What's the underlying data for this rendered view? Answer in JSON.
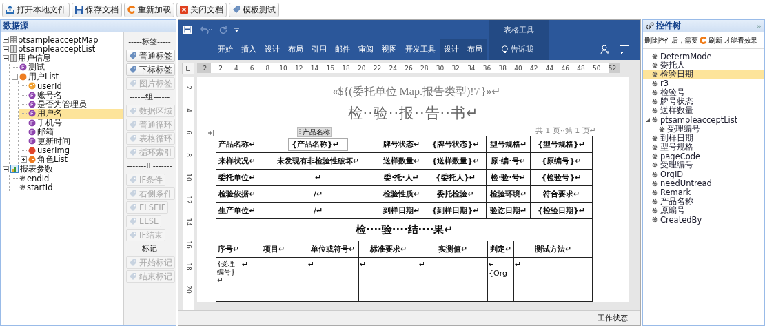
{
  "toolbar": [
    {
      "kind": "open",
      "label": "打开本地文件"
    },
    {
      "kind": "save",
      "label": "保存文档"
    },
    {
      "kind": "reload",
      "label": "重新加载"
    },
    {
      "kind": "close",
      "label": "关闭文档"
    },
    {
      "kind": "test",
      "label": "模板测试"
    }
  ],
  "datasource": {
    "title": "数据源",
    "tree": [
      {
        "kind": "table",
        "label": "ptsampleacceptMap",
        "expanded": false,
        "selected": false
      },
      {
        "kind": "table",
        "label": "ptsampleacceptList",
        "expanded": false,
        "selected": false
      },
      {
        "kind": "table",
        "label": "用户信息",
        "expanded": true,
        "selected": false,
        "children": [
          {
            "kind": "field",
            "label": "测试",
            "selected": false
          },
          {
            "kind": "list",
            "label": "用户List",
            "expanded": true,
            "selected": false,
            "children": [
              {
                "kind": "key",
                "label": "userId",
                "selected": false
              },
              {
                "kind": "field",
                "label": "账号名",
                "selected": false
              },
              {
                "kind": "field",
                "label": "是否为管理员",
                "selected": false
              },
              {
                "kind": "field",
                "label": "用户名",
                "selected": true
              },
              {
                "kind": "field",
                "label": "手机号",
                "selected": false
              },
              {
                "kind": "field",
                "label": "邮箱",
                "selected": false
              },
              {
                "kind": "field",
                "label": "更新时间",
                "selected": false
              },
              {
                "kind": "image",
                "label": "userImg",
                "selected": false
              },
              {
                "kind": "list",
                "label": "角色List",
                "expanded": false,
                "selected": false
              }
            ]
          }
        ]
      },
      {
        "kind": "report",
        "label": "报表参数",
        "expanded": true,
        "selected": false,
        "children": [
          {
            "kind": "param",
            "label": "endId",
            "selected": false
          },
          {
            "kind": "param",
            "label": "startId",
            "selected": false
          }
        ]
      }
    ]
  },
  "tag_palette": [
    {
      "kind": "heading",
      "label": "-----标签-----"
    },
    {
      "kind": "button",
      "label": "普通标签",
      "disabled": false
    },
    {
      "kind": "button",
      "label": "下标标签",
      "disabled": false
    },
    {
      "kind": "button",
      "label": "图片标签",
      "disabled": true
    },
    {
      "kind": "heading",
      "label": "------组------"
    },
    {
      "kind": "button",
      "label": "数据区域",
      "disabled": true
    },
    {
      "kind": "button",
      "label": "普通循环",
      "disabled": true
    },
    {
      "kind": "button",
      "label": "表格循环",
      "disabled": true
    },
    {
      "kind": "button",
      "label": "循环索引",
      "disabled": true
    },
    {
      "kind": "heading",
      "label": "-------IF-------"
    },
    {
      "kind": "button",
      "label": "IF条件",
      "disabled": true
    },
    {
      "kind": "button",
      "label": "右侧条件",
      "disabled": true
    },
    {
      "kind": "button",
      "label": "ELSEIF",
      "disabled": true
    },
    {
      "kind": "button",
      "label": "ELSE",
      "disabled": true
    },
    {
      "kind": "button",
      "label": "IF结束",
      "disabled": true
    },
    {
      "kind": "heading",
      "label": "-----标记-----"
    },
    {
      "kind": "button",
      "label": "开始标记",
      "disabled": true
    },
    {
      "kind": "button",
      "label": "结束标记",
      "disabled": true
    }
  ],
  "ribbon": {
    "context_group": "表格工具",
    "tabs": [
      {
        "label": "开始",
        "contextual": false
      },
      {
        "label": "插入",
        "contextual": false
      },
      {
        "label": "设计",
        "contextual": false
      },
      {
        "label": "布局",
        "contextual": false
      },
      {
        "label": "引用",
        "contextual": false
      },
      {
        "label": "邮件",
        "contextual": false
      },
      {
        "label": "审阅",
        "contextual": false
      },
      {
        "label": "视图",
        "contextual": false
      },
      {
        "label": "开发工具",
        "contextual": false
      },
      {
        "label": "设计",
        "contextual": true
      },
      {
        "label": "布局",
        "contextual": true
      }
    ],
    "tell_me": "告诉我"
  },
  "ruler": {
    "numbers": [
      "2",
      "2",
      "4",
      "6",
      "8",
      "10",
      "12",
      "14",
      "16",
      "18",
      "20",
      "22",
      "24",
      "26",
      "28",
      "30",
      "32",
      "34",
      "36",
      "38",
      "40",
      "42",
      "44",
      "46",
      "48",
      "50",
      "52"
    ]
  },
  "vertical_ruler": {
    "numbers": [
      "2",
      "4",
      "6",
      "8",
      "10",
      "12",
      "14",
      "16",
      "18",
      "20"
    ]
  },
  "document": {
    "header_expr": "«${(委托单位 Map.报告类型)!'/'}»↵",
    "title": "检··验··报··告··书↵",
    "page_info": "共 1 页··第 1 页↵",
    "field_tag": "产品名称",
    "info_table": [
      [
        "产品名称↵",
        "{产品名称}↵",
        "牌号状态↵",
        "{牌号状态}↵",
        "型号规格↵",
        "{型号规格}↵"
      ],
      [
        "来样状况↵",
        "未发现有非检验性破坏↵",
        "送样数量↵",
        "{送样数量}↵",
        "原·编·号↵",
        "{原编号}↵"
      ],
      [
        "委托单位↵",
        "↵",
        "委·托·人↵",
        "{委托人}↵",
        "检·验·号↵",
        "{检验号}↵"
      ],
      [
        "检验依据↵",
        "/↵",
        "检验性质↵",
        "委托检验↵",
        "检验环境↵",
        "符合要求↵"
      ],
      [
        "生产单位↵",
        "/↵",
        "到样日期↵",
        "{到样日期}↵",
        "验讫日期↵",
        "{检验日期}↵"
      ]
    ],
    "result_heading": "检····验····结····果↵",
    "result_columns": [
      "序号↵",
      "项目↵",
      "单位或符号↵",
      "标准要求↵",
      "实测值↵",
      "判定↵",
      "测试方法↵"
    ],
    "result_row": [
      "{受理编号}↵",
      "↵",
      "↵",
      "↵",
      "↵",
      "↵\n{Org",
      "↵"
    ]
  },
  "status_bar": {
    "text": "工作状态"
  },
  "control_tree": {
    "title": "控件树",
    "collapse": "»",
    "hint_before": "删除控件后，需要",
    "refresh": "刷新",
    "hint_after": "才能看效果",
    "items": [
      {
        "label": "DetermMode",
        "selected": false
      },
      {
        "label": "委托人",
        "selected": false
      },
      {
        "label": "检验日期",
        "selected": true
      },
      {
        "label": "r3",
        "selected": false
      },
      {
        "label": "检验号",
        "selected": false
      },
      {
        "label": "牌号状态",
        "selected": false
      },
      {
        "label": "送样数量",
        "selected": false
      },
      {
        "label": "ptsampleacceptList",
        "selected": false,
        "expanded": true,
        "children": [
          {
            "label": "受理编号",
            "selected": false
          }
        ]
      },
      {
        "label": "到样日期",
        "selected": false
      },
      {
        "label": "型号规格",
        "selected": false
      },
      {
        "label": "pageCode",
        "selected": false
      },
      {
        "label": "受理编号",
        "selected": false
      },
      {
        "label": "OrgID",
        "selected": false
      },
      {
        "label": "needUntread",
        "selected": false
      },
      {
        "label": "Remark",
        "selected": false
      },
      {
        "label": "产品名称",
        "selected": false
      },
      {
        "label": "原编号",
        "selected": false
      },
      {
        "label": "CreatedBy",
        "selected": false
      }
    ]
  }
}
